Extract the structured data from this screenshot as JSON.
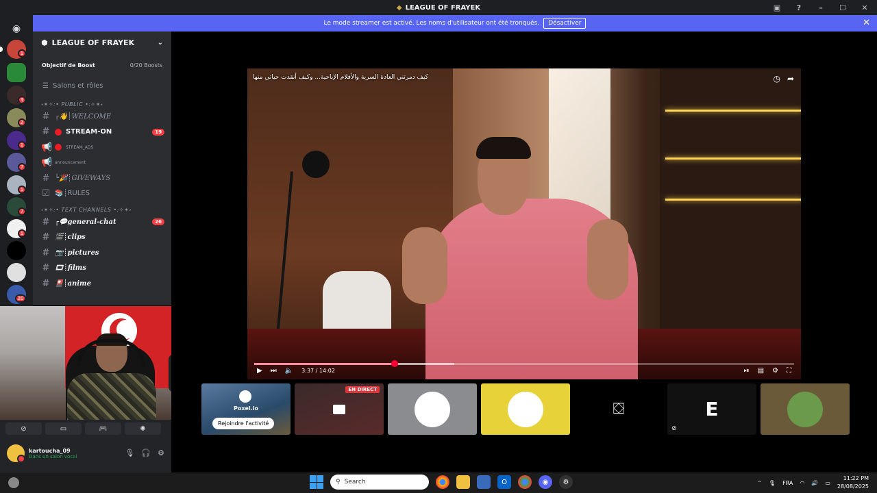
{
  "window": {
    "title": "LEAGUE OF FRAYEK"
  },
  "banner": {
    "text": "Le mode streamer est activé. Les noms d'utilisateur ont été tronqués.",
    "button": "Désactiver"
  },
  "guilds": {
    "badges": [
      "1",
      "",
      "3",
      "2",
      "1",
      "7",
      "1",
      "7",
      "1",
      "",
      "",
      "20"
    ]
  },
  "server": {
    "name": "LEAGUE OF FRAYEK",
    "boost_label": "Objectif de Boost",
    "boost_count": "0/20 Boosts",
    "roles_label": "Salons et rôles",
    "categories": [
      "˖✶✧:• PUBLIC •:✧✶˖",
      "˖✶✧:• TEXT CHANNELS •:✧✶˖"
    ],
    "channels": [
      {
        "name": "┌👋┊WELCOME",
        "count": ""
      },
      {
        "name": "STREAM-ON",
        "count": "19"
      },
      {
        "name": "STREAM_ADS",
        "count": ""
      },
      {
        "name": "announcement",
        "count": ""
      },
      {
        "name": "└🎉┊GIVEWAYS",
        "count": ""
      },
      {
        "name": "📚┊RULES",
        "count": ""
      },
      {
        "name": "┌💬general-chat",
        "count": "26"
      },
      {
        "name": "🎬┊clips",
        "count": ""
      },
      {
        "name": "📷┊pictures",
        "count": ""
      },
      {
        "name": "🎞┊films",
        "count": ""
      },
      {
        "name": "🎴┊anime",
        "count": ""
      }
    ]
  },
  "user": {
    "name": "kartoucha_09",
    "status": "Dans un salon vocal"
  },
  "video": {
    "title": "كيف دمرتني العادة السرية والأفلام الإباحية... وكيف أنقذت حياتي منها",
    "time": "3:37 / 14:02",
    "progress": 0.26,
    "buffered": 0.37
  },
  "tiles": {
    "activity_brand": "Poxel.io",
    "activity_join": "Rejoindre l'activité",
    "live_badge": "EN DIRECT"
  },
  "taskbar": {
    "search_placeholder": "Search",
    "lang": "FRA",
    "time": "11:22 PM",
    "date": "28/08/2025"
  },
  "colors": {
    "accent": "#5865f2",
    "danger": "#f23f43",
    "progress": "#ff0033"
  }
}
